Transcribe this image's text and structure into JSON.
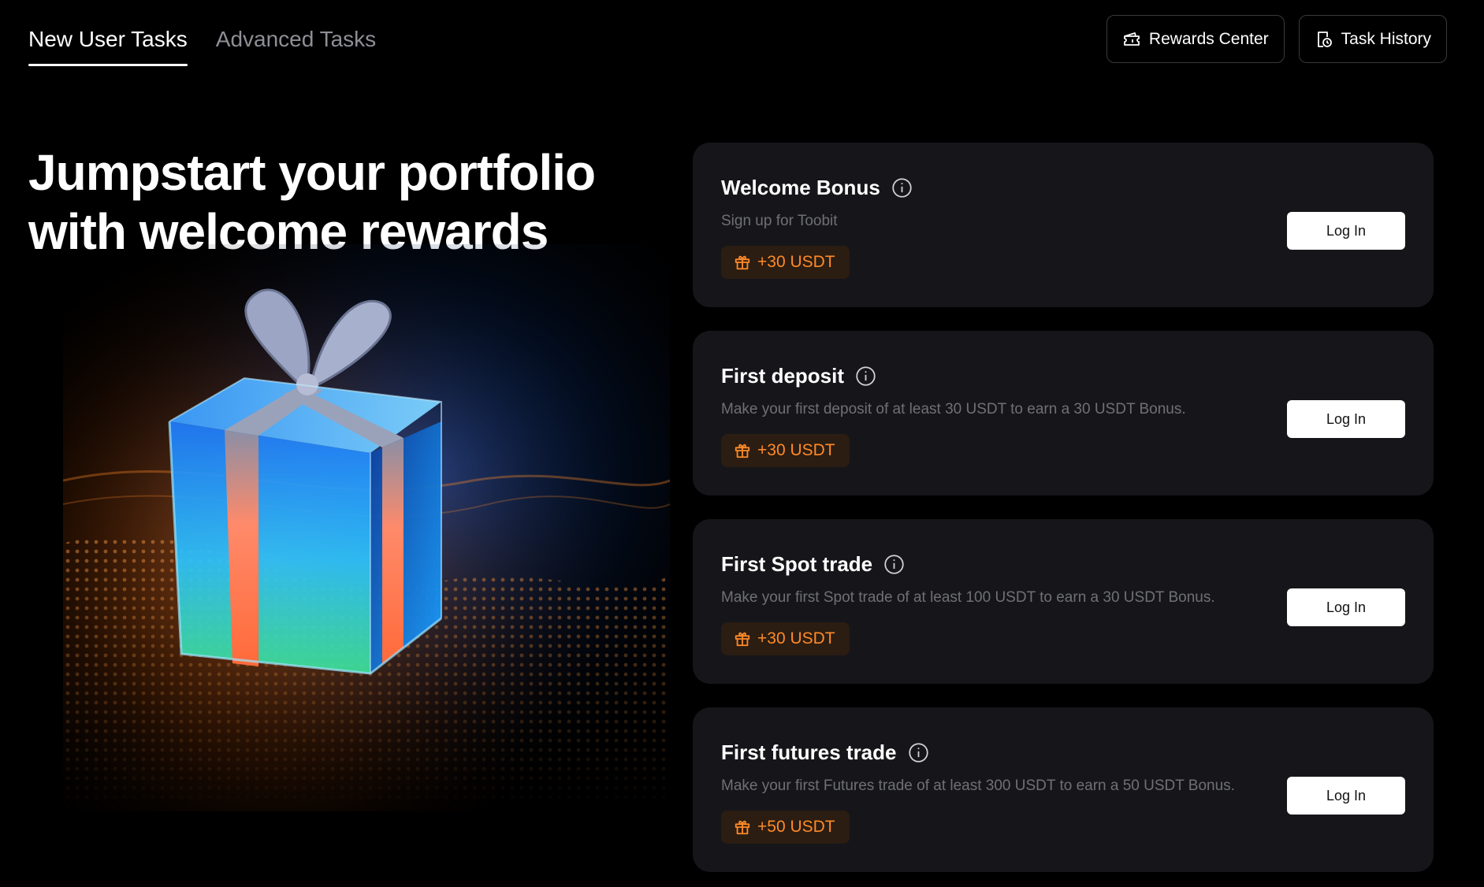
{
  "nav": {
    "tabs": [
      {
        "label": "New User Tasks",
        "active": true
      },
      {
        "label": "Advanced Tasks",
        "active": false
      }
    ],
    "rewards_center_label": "Rewards Center",
    "task_history_label": "Task History"
  },
  "hero": {
    "title_line1": "Jumpstart your portfolio",
    "title_line2": "with welcome rewards",
    "image_icon": "gift-box-illustration"
  },
  "tasks": [
    {
      "title": "Welcome Bonus",
      "description": "Sign up for Toobit",
      "reward": "+30 USDT",
      "button": "Log In"
    },
    {
      "title": "First deposit",
      "description": "Make your first deposit of at least 30 USDT to earn a 30 USDT Bonus.",
      "reward": "+30 USDT",
      "button": "Log In"
    },
    {
      "title": "First Spot trade",
      "description": "Make your first Spot trade of at least 100 USDT to earn a 30 USDT Bonus.",
      "reward": "+30 USDT",
      "button": "Log In"
    },
    {
      "title": "First futures trade",
      "description": "Make your first Futures trade of at least 300 USDT to earn a 50 USDT Bonus.",
      "reward": "+50 USDT",
      "button": "Log In"
    }
  ],
  "colors": {
    "background": "#000000",
    "card": "#16161a",
    "accent_orange": "#ff8a28",
    "badge_bg": "#2b1d12",
    "muted_text": "#6f7077"
  }
}
